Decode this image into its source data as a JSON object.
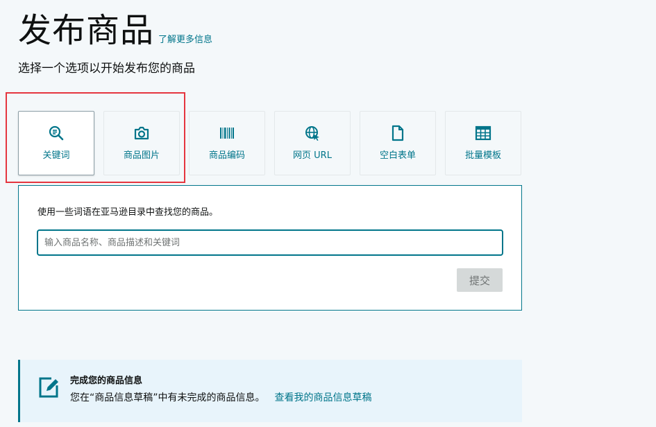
{
  "header": {
    "title": "发布商品",
    "learn_more": "了解更多信息",
    "subtitle": "选择一个选项以开始发布您的商品"
  },
  "options": [
    {
      "label": "关键词",
      "icon": "keyword-search-icon",
      "active": true
    },
    {
      "label": "商品图片",
      "icon": "camera-icon",
      "active": false
    },
    {
      "label": "商品编码",
      "icon": "barcode-icon",
      "active": false
    },
    {
      "label": "网页 URL",
      "icon": "globe-link-icon",
      "active": false
    },
    {
      "label": "空白表单",
      "icon": "blank-document-icon",
      "active": false
    },
    {
      "label": "批量模板",
      "icon": "spreadsheet-icon",
      "active": false
    }
  ],
  "keyword_panel": {
    "description": "使用一些词语在亚马逊目录中查找您的商品。",
    "input_placeholder": "输入商品名称、商品描述和关键词",
    "input_value": "",
    "submit_label": "提交"
  },
  "draft_banner": {
    "title": "完成您的商品信息",
    "text": "您在“商品信息草稿”中有未完成的商品信息。",
    "link": "查看我的商品信息草稿"
  },
  "colors": {
    "accent": "#00758a",
    "highlight": "#e5353e",
    "background": "#f4f8fa",
    "banner": "#e8f4fb"
  }
}
